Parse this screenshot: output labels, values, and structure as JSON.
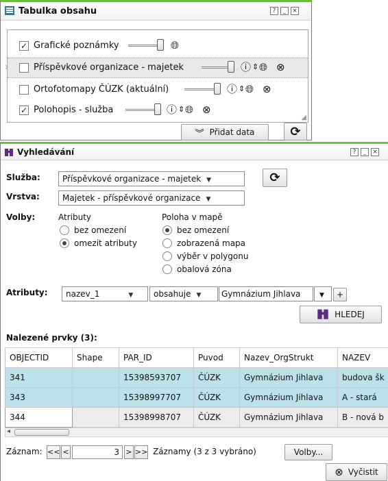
{
  "toc": {
    "title": "Tabulka obsahu",
    "title_icon": "table-of-contents-icon",
    "window_buttons": [
      "?",
      "_",
      "×"
    ],
    "layers": [
      {
        "label": "Grafické poznámky",
        "checked": true,
        "icons": [
          "globe"
        ]
      },
      {
        "label": "Příspěvkové organizace - majetek",
        "checked": false,
        "expandable": true,
        "highlighted": true,
        "icons": [
          "info",
          "up-down",
          "globe",
          "remove"
        ]
      },
      {
        "label": "Ortofotomapy ČÚZK (aktuální)",
        "checked": false,
        "icons": [
          "info",
          "up-down",
          "globe",
          "remove"
        ]
      },
      {
        "label": "Polohopis - služba",
        "checked": true,
        "icons": [
          "info",
          "up-down",
          "globe",
          "remove"
        ]
      }
    ],
    "add_data_label": "Přidat data",
    "refresh_icon": "refresh-icon"
  },
  "search": {
    "title": "Vyhledávání",
    "title_icon": "binoculars-icon",
    "window_buttons": [
      "?",
      "_",
      "×"
    ],
    "service_label": "Služba:",
    "service_value": "Příspěvkové organizace - majetek",
    "layer_label": "Vrstva:",
    "layer_value": "Majetek - příspěvkové organizace",
    "options_label": "Volby:",
    "attr_group_title": "Atributy",
    "attr_options": [
      {
        "label": "bez omezení",
        "selected": false
      },
      {
        "label": "omezit atributy",
        "selected": true
      }
    ],
    "location_group_title": "Poloha v mapě",
    "location_options": [
      {
        "label": "bez omezení",
        "selected": true
      },
      {
        "label": "zobrazená mapa",
        "selected": false
      },
      {
        "label": "výběr v polygonu",
        "selected": false
      },
      {
        "label": "obalová zóna",
        "selected": false
      }
    ],
    "attributes_label": "Atributy:",
    "attribute_field": "nazev_1",
    "operator": "obsahuje",
    "attribute_value": "Gymnázium Jihlava",
    "add_condition": "+",
    "search_button": "HLEDEJ",
    "results_title": "Nalezené prvky (3):",
    "columns": [
      "OBJECTID",
      "Shape",
      "PAR_ID",
      "Puvod",
      "Nazev_OrgStrukt",
      "NAZEV"
    ],
    "rows": [
      [
        "341",
        "",
        "15398593707",
        "ČÚZK",
        "Gymnázium Jihlava",
        "budova šk"
      ],
      [
        "343",
        "",
        "15398997707",
        "ČÚZK",
        "Gymnázium Jihlava",
        "A - stará"
      ],
      [
        "344",
        "",
        "15398998707",
        "ČÚZK",
        "Gymnázium Jihlava",
        "B - nová b"
      ]
    ],
    "record_label": "Záznam:",
    "nav_first": "<<",
    "nav_prev": "<",
    "current_record": "3",
    "nav_next": ">",
    "nav_last": ">>",
    "records_status": "Záznamy (3 z 3 vybráno)",
    "options_button": "Volby...",
    "clear_button": "Vyčistit"
  },
  "colors": {
    "accent": "#6cbf3b",
    "selected_row": "#bde1eb",
    "row_gray": "#ececec"
  }
}
